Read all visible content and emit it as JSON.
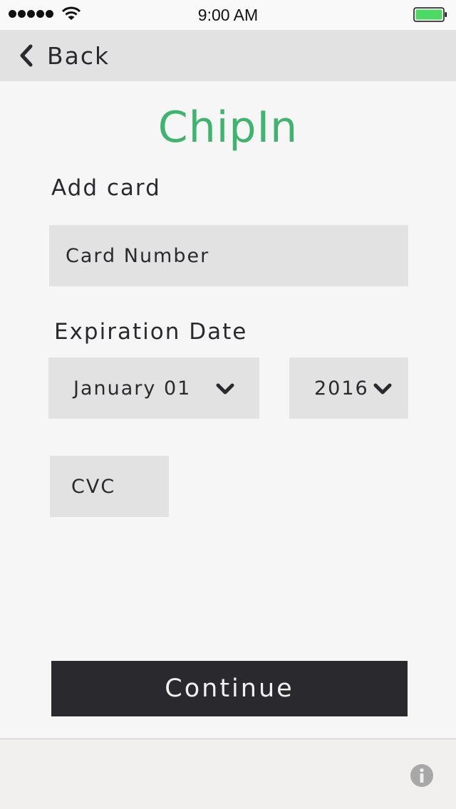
{
  "status_bar": {
    "time": "9:00 AM",
    "icons": [
      "signal-dots-icon",
      "wifi-icon",
      "battery-icon"
    ],
    "battery_color": "#4cd964"
  },
  "nav": {
    "back_label": "Back",
    "back_icon": "chevron-left-icon"
  },
  "app": {
    "title": "ChipIn",
    "brand_color": "#3fb46e"
  },
  "form": {
    "heading": "Add card",
    "card_number_placeholder": "Card Number",
    "expiration_heading": "Expiration Date",
    "month_value": "January 01",
    "year_value": "2016",
    "cvc_placeholder": "CVC"
  },
  "actions": {
    "continue_label": "Continue"
  },
  "footer": {
    "icon": "info-icon"
  }
}
